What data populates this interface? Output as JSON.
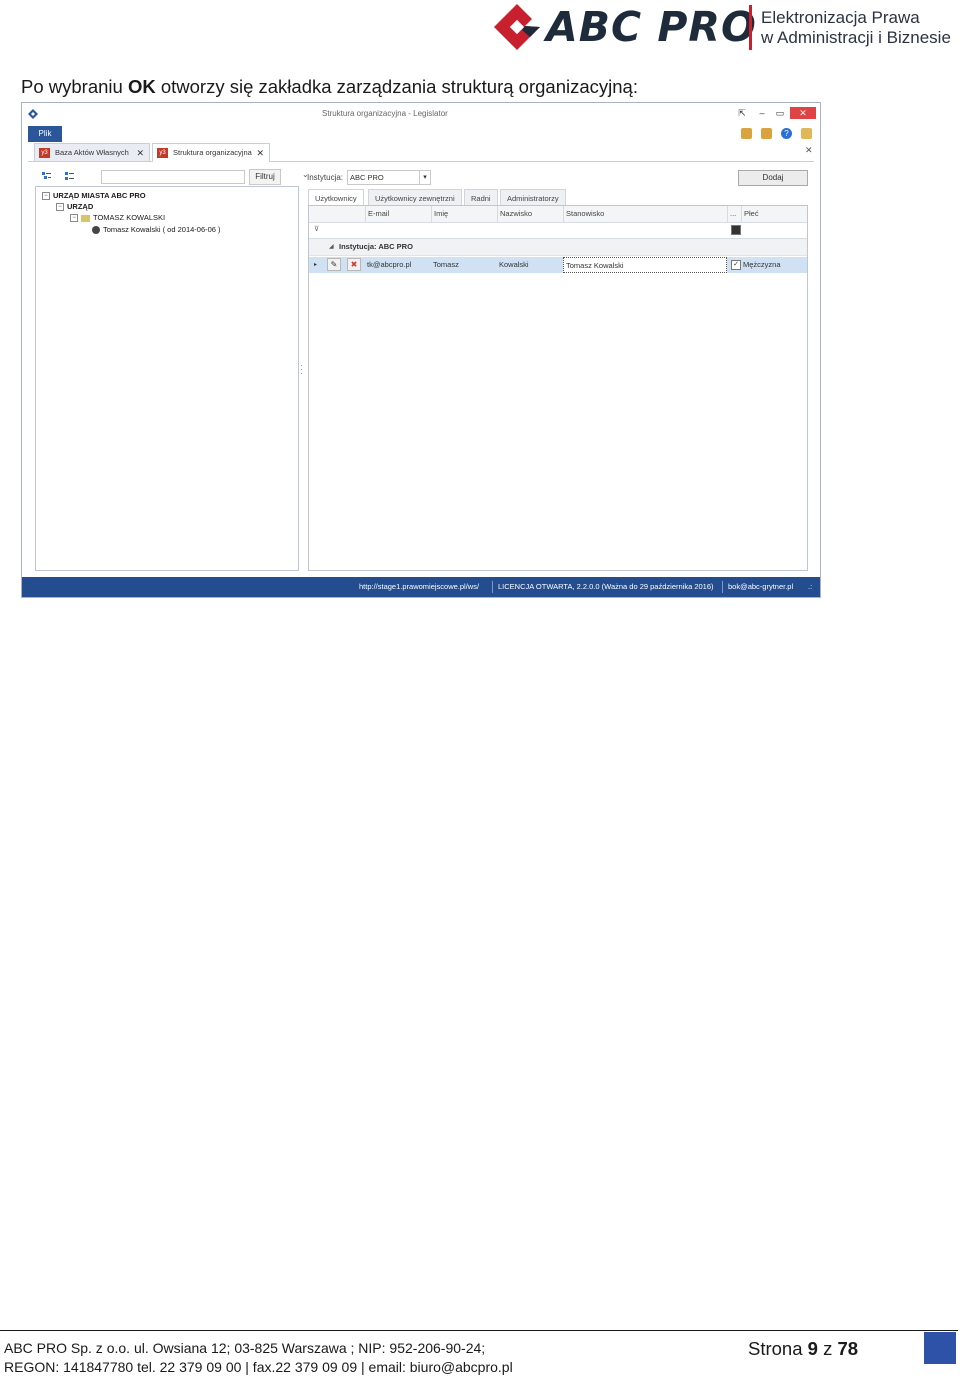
{
  "header": {
    "logo_text": "ABC PRO",
    "tagline_line1": "Elektronizacja Prawa",
    "tagline_line2": "w Administracji i Biznesie"
  },
  "intro": {
    "before": "Po wybraniu ",
    "bold": "OK",
    "after": " otworzy się zakładka zarządzania strukturą organizacyjną:"
  },
  "window": {
    "title": "Struktura organizacyjna - Legislator",
    "menu_label": "Plik",
    "tabs": [
      {
        "label": "Baza Aktów Własnych",
        "icon": "document-tab-icon"
      },
      {
        "label": "Struktura organizacyjna",
        "icon": "document-tab-icon"
      }
    ],
    "left_pane": {
      "filter_button": "Filtruj",
      "tree": [
        {
          "label": "URZĄD MIASTA ABC PRO",
          "bold": true
        },
        {
          "label": "URZĄD",
          "bold": true
        },
        {
          "label": "TOMASZ KOWALSKI",
          "bold": false
        },
        {
          "label": "Tomasz Kowalski ( od 2014-06-06 )",
          "bold": false
        }
      ]
    },
    "right_pane": {
      "institution_label": "Instytucja:",
      "institution_value": "ABC PRO",
      "add_button": "Dodaj",
      "tabs": [
        "Użytkownicy",
        "Użytkownicy zewnętrzni",
        "Radni",
        "Administratorzy"
      ],
      "columns": [
        "E-mail",
        "Imię",
        "Nazwisko",
        "Stanowisko",
        "...",
        "Płeć"
      ],
      "group_label": "Instytucja: ABC PRO",
      "row": {
        "email": "tk@abcpro.pl",
        "first_name": "Tomasz",
        "last_name": "Kowalski",
        "position": "Tomasz Kowalski",
        "gender": "Mężczyzna",
        "gender_checked": true
      }
    },
    "status_bar": {
      "url": "http://stage1.prawomiejscowe.pl/ws/",
      "license": "LICENCJA OTWARTA, 2.2.0.0 (Ważna do 29 października 2016)",
      "email": "bok@abc-grytner.pl",
      "grip": ".:"
    }
  },
  "footer": {
    "line1": "ABC PRO Sp. z o.o. ul. Owsiana 12;  03-825 Warszawa ; NIP: 952-206-90-24;",
    "line2": "REGON: 141847780 tel. 22 379 09 00 | fax.22 379 09 09 | email: biuro@abcpro.pl",
    "page_prefix": "Strona ",
    "page_current": "9",
    "page_middle": " z ",
    "page_total": "78"
  },
  "colors": {
    "brand_red": "#c8202e",
    "brand_navy": "#1d2b3b",
    "status_bar": "#234d8f",
    "footer_square": "#2e52a8"
  }
}
